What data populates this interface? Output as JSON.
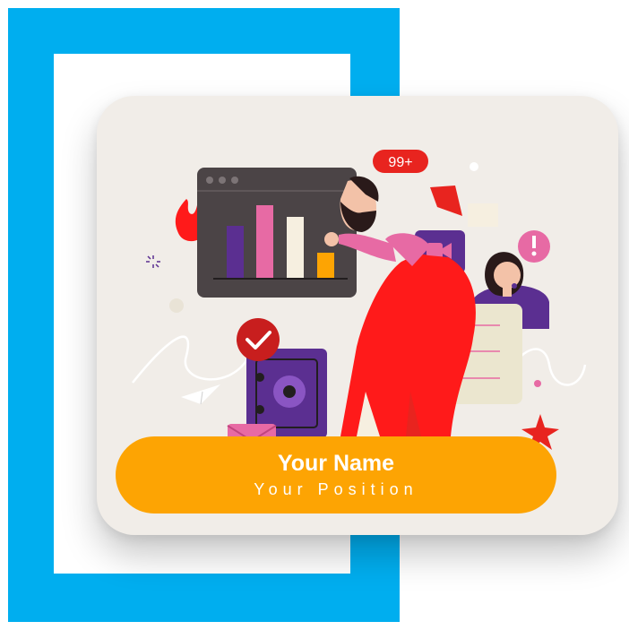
{
  "profile_card": {
    "notification_badge": "99+",
    "name": "Your Name",
    "position": "Your Position"
  },
  "colors": {
    "frame_blue": "#00aeef",
    "card_bg": "#f1ede8",
    "pill_orange": "#fda403",
    "accent_red": "#ff1a1a",
    "accent_purple": "#5b2f91",
    "accent_pink": "#e76aa4"
  },
  "icons": [
    "fire-icon",
    "checkmark-icon",
    "video-camera-icon",
    "alert-icon",
    "paper-plane-icon",
    "envelope-icon",
    "star-icon",
    "safe-icon"
  ]
}
